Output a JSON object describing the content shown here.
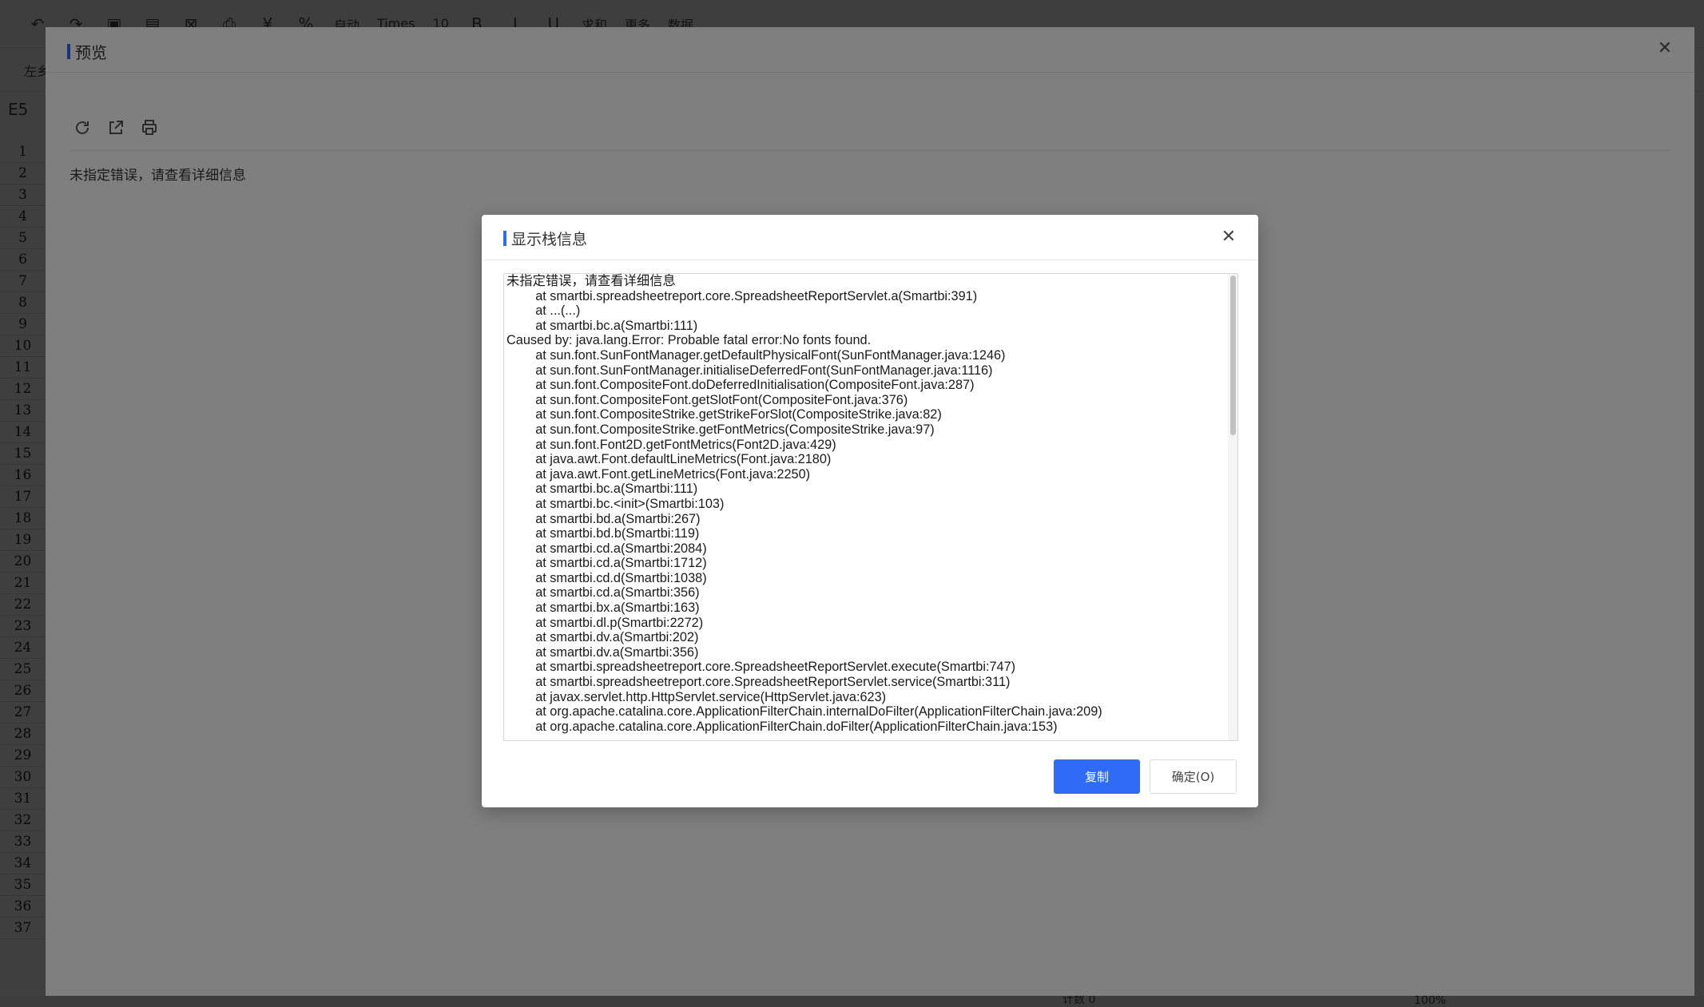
{
  "app": {
    "toolbar": {
      "font_size_value": "10",
      "font_name_value": "Times",
      "auto_label": "自动",
      "sum_label": "求和",
      "more_label": "更多",
      "data_label": "数据"
    },
    "left_label": "左乡",
    "cell_ref": "E5",
    "row_numbers": [
      "1",
      "2",
      "3",
      "4",
      "5",
      "6",
      "7",
      "8",
      "9",
      "10",
      "11",
      "12",
      "13",
      "14",
      "15",
      "16",
      "17",
      "18",
      "19",
      "20",
      "21",
      "22",
      "23",
      "24",
      "25",
      "26",
      "27",
      "28",
      "29",
      "30",
      "31",
      "32",
      "33",
      "34",
      "35",
      "36",
      "37"
    ],
    "status": {
      "count_label": "计数 0",
      "zoom_label": "100%"
    }
  },
  "preview": {
    "title": "预览",
    "close_glyph": "✕",
    "message": "未指定错误，请查看详细信息"
  },
  "dialog": {
    "title": "显示栈信息",
    "close_glyph": "✕",
    "stack_lines": [
      "未指定错误，请查看详细信息",
      "        at smartbi.spreadsheetreport.core.SpreadsheetReportServlet.a(Smartbi:391)",
      "        at ...(...)",
      "        at smartbi.bc.a(Smartbi:111)",
      "Caused by: java.lang.Error: Probable fatal error:No fonts found.",
      "        at sun.font.SunFontManager.getDefaultPhysicalFont(SunFontManager.java:1246)",
      "        at sun.font.SunFontManager.initialiseDeferredFont(SunFontManager.java:1116)",
      "        at sun.font.CompositeFont.doDeferredInitialisation(CompositeFont.java:287)",
      "        at sun.font.CompositeFont.getSlotFont(CompositeFont.java:376)",
      "        at sun.font.CompositeStrike.getStrikeForSlot(CompositeStrike.java:82)",
      "        at sun.font.CompositeStrike.getFontMetrics(CompositeStrike.java:97)",
      "        at sun.font.Font2D.getFontMetrics(Font2D.java:429)",
      "        at java.awt.Font.defaultLineMetrics(Font.java:2180)",
      "        at java.awt.Font.getLineMetrics(Font.java:2250)",
      "        at smartbi.bc.a(Smartbi:111)",
      "        at smartbi.bc.<init>(Smartbi:103)",
      "        at smartbi.bd.a(Smartbi:267)",
      "        at smartbi.bd.b(Smartbi:119)",
      "        at smartbi.cd.a(Smartbi:2084)",
      "        at smartbi.cd.a(Smartbi:1712)",
      "        at smartbi.cd.d(Smartbi:1038)",
      "        at smartbi.cd.a(Smartbi:356)",
      "        at smartbi.bx.a(Smartbi:163)",
      "        at smartbi.dl.p(Smartbi:2272)",
      "        at smartbi.dv.a(Smartbi:202)",
      "        at smartbi.dv.a(Smartbi:356)",
      "        at smartbi.spreadsheetreport.core.SpreadsheetReportServlet.execute(Smartbi:747)",
      "        at smartbi.spreadsheetreport.core.SpreadsheetReportServlet.service(Smartbi:311)",
      "        at javax.servlet.http.HttpServlet.service(HttpServlet.java:623)",
      "        at org.apache.catalina.core.ApplicationFilterChain.internalDoFilter(ApplicationFilterChain.java:209)",
      "        at org.apache.catalina.core.ApplicationFilterChain.doFilter(ApplicationFilterChain.java:153)"
    ],
    "copy_label": "复制",
    "ok_label": "确定(O)"
  },
  "colors": {
    "accent": "#2f6bf6",
    "overlay": "rgba(0,0,0,0.5)"
  }
}
